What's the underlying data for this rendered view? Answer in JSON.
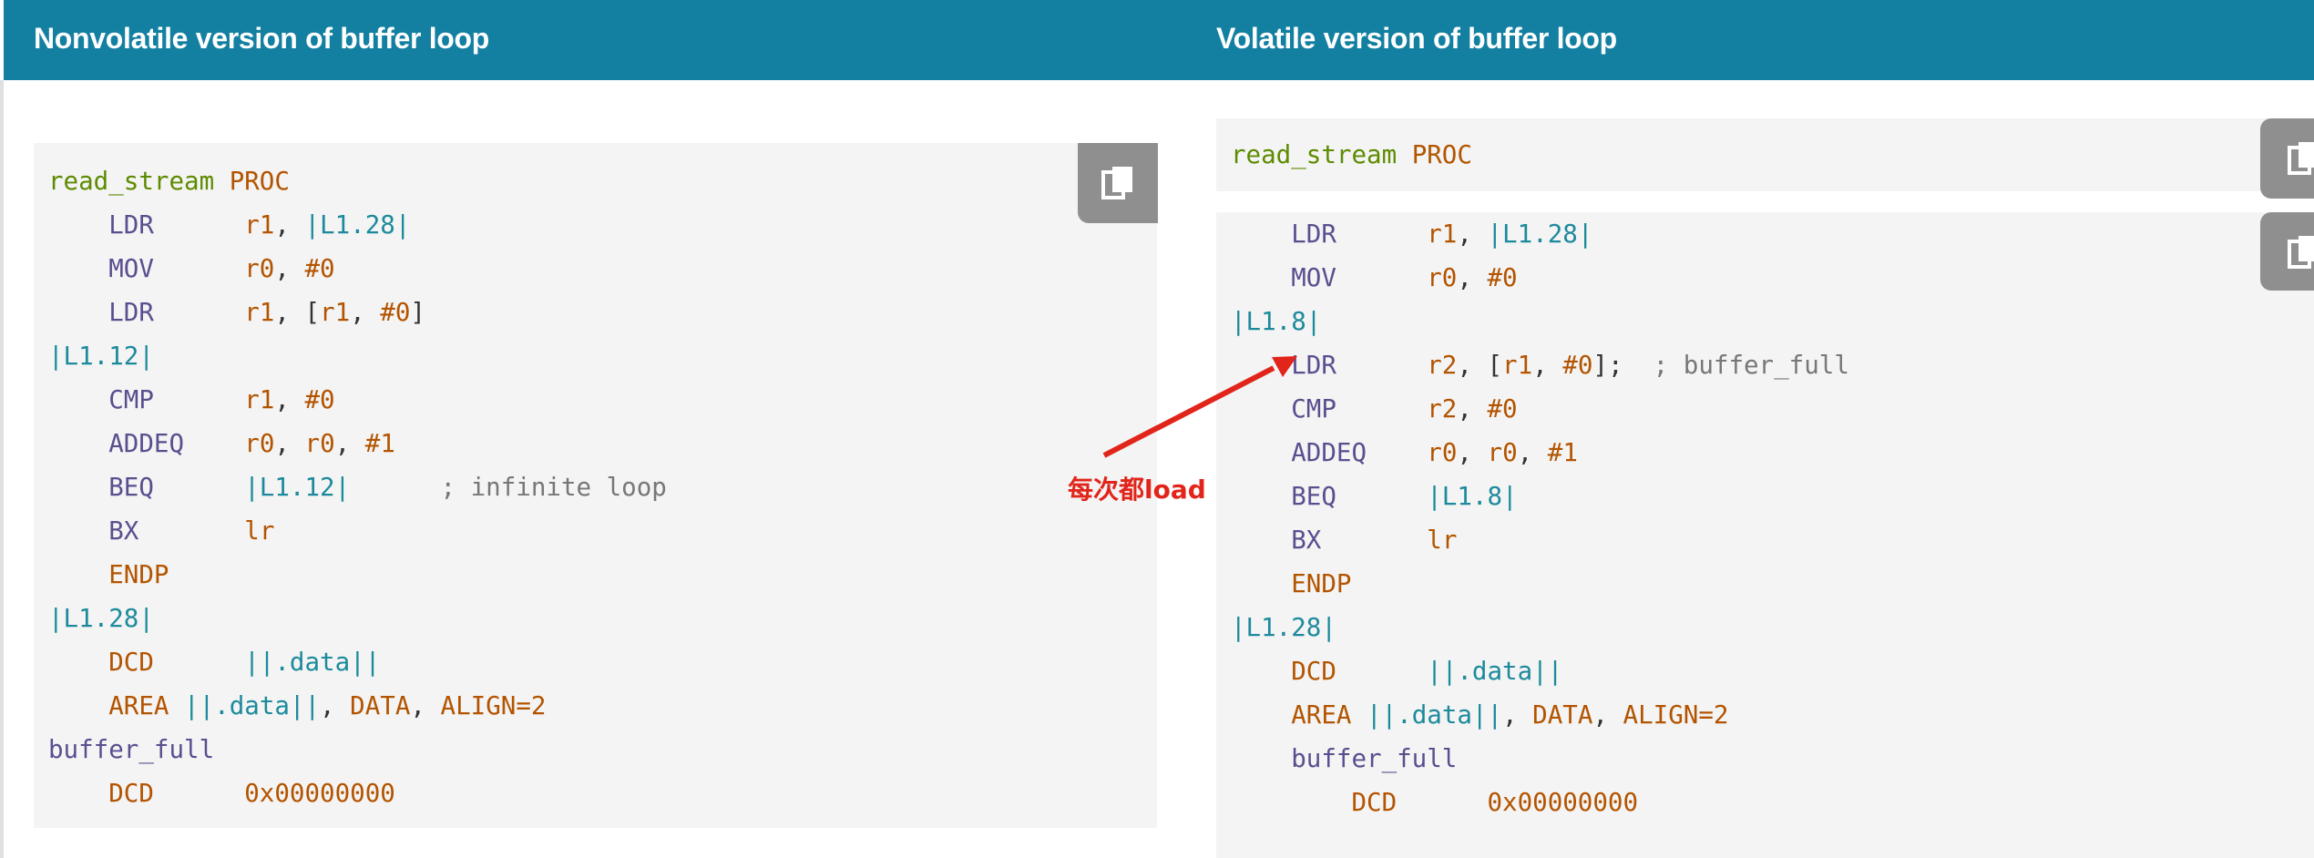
{
  "left_panel": {
    "title": "Nonvolatile version of buffer loop",
    "code": {
      "l1_label": "read_stream",
      "l1_kw": "PROC",
      "l2_op": "LDR",
      "l2_r": "r1",
      "l2_lbl": "|L1.28|",
      "l3_op": "MOV",
      "l3_r": "r0",
      "l3_v": "#0",
      "l4_op": "LDR",
      "l4_r1": "r1",
      "l4_r2": "r1",
      "l4_v": "#0",
      "l5_label": "|L1.12|",
      "l6_op": "CMP",
      "l6_r": "r1",
      "l6_v": "#0",
      "l7_op": "ADDEQ",
      "l7_r1": "r0",
      "l7_r2": "r0",
      "l7_v": "#1",
      "l8_op": "BEQ",
      "l8_lbl": "|L1.12|",
      "l8_cm": "; infinite loop",
      "l9_op": "BX",
      "l9_r": "lr",
      "l10_kw": "ENDP",
      "l11_label": "|L1.28|",
      "l12_op": "DCD",
      "l12_lbl": "||.data||",
      "l13_kw": "AREA",
      "l13_lbl": "||.data||",
      "l13_d": "DATA",
      "l13_a": "ALIGN=2",
      "l14_op": "buffer_full",
      "l15_op": "DCD",
      "l15_v": "0x00000000"
    }
  },
  "right_panel": {
    "title": "Volatile version of buffer loop",
    "code_top": {
      "label": "read_stream",
      "kw": "PROC"
    },
    "code": {
      "l1_op": "LDR",
      "l1_r": "r1",
      "l1_lbl": "|L1.28|",
      "l2_op": "MOV",
      "l2_r": "r0",
      "l2_v": "#0",
      "l3_label": "|L1.8|",
      "l4_op": "LDR",
      "l4_r": "r2",
      "l4_r2": "r1",
      "l4_v": "#0",
      "l4_cm": "; buffer_full",
      "l5_op": "CMP",
      "l5_r": "r2",
      "l5_v": "#0",
      "l6_op": "ADDEQ",
      "l6_r1": "r0",
      "l6_r2": "r0",
      "l6_v": "#1",
      "l7_op": "BEQ",
      "l7_lbl": "|L1.8|",
      "l8_op": "BX",
      "l8_r": "lr",
      "l9_kw": "ENDP",
      "l10_label": "|L1.28|",
      "l11_op": "DCD",
      "l11_lbl": "||.data||",
      "l12_kw": "AREA",
      "l12_lbl": "||.data||",
      "l12_d": "DATA",
      "l12_a": "ALIGN=2",
      "l13_op": "buffer_full",
      "l14_op": "DCD",
      "l14_v": "0x00000000"
    }
  },
  "annotation": {
    "text": "每次都load",
    "color": "#e1251b"
  },
  "icons": {
    "copy": "copy-icon"
  }
}
